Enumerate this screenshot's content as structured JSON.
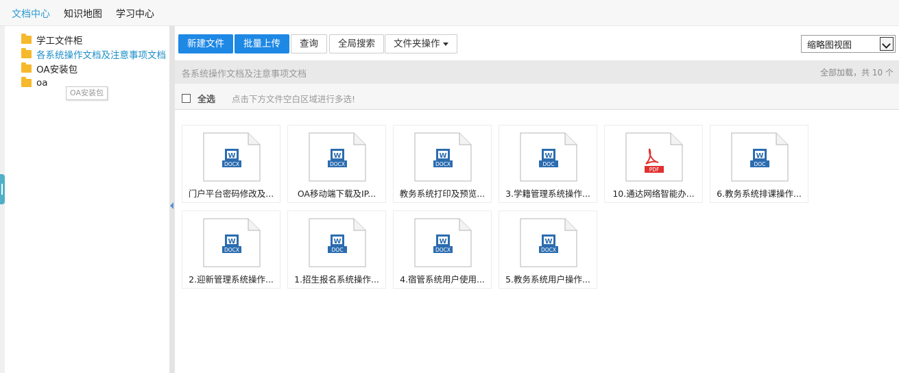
{
  "topnav": {
    "items": [
      {
        "label": "文档中心",
        "active": true
      },
      {
        "label": "知识地图",
        "active": false
      },
      {
        "label": "学习中心",
        "active": false
      }
    ]
  },
  "sidebar": {
    "folders": [
      {
        "label": "学工文件柜",
        "active": false
      },
      {
        "label": "各系统操作文档及注意事项文档",
        "active": true
      },
      {
        "label": "OA安装包",
        "active": false
      },
      {
        "label": "oa",
        "active": false
      }
    ],
    "tooltip": "OA安装包"
  },
  "toolbar": {
    "new_file": "新建文件",
    "batch_upload": "批量上传",
    "query": "查询",
    "global_search": "全局搜索",
    "folder_ops": "文件夹操作",
    "view_mode": "缩略图视图"
  },
  "pathbar": {
    "path": "各系统操作文档及注意事项文档",
    "count": "全部加载，共 10 个"
  },
  "selectbar": {
    "select_all": "全选",
    "hint": "点击下方文件空白区域进行多选!"
  },
  "colors": {
    "word": "#2b6cb0",
    "pdf": "#e03131",
    "primary": "#1e88e5",
    "active_text": "#1f8fc9"
  },
  "files": [
    {
      "name": "门户平台密码修改及...",
      "type": "DOCX",
      "icon": "word-icon"
    },
    {
      "name": "OA移动端下载及IP...",
      "type": "DOCX",
      "icon": "word-icon"
    },
    {
      "name": "教务系统打印及预览...",
      "type": "DOCX",
      "icon": "word-icon"
    },
    {
      "name": "3.学籍管理系统操作...",
      "type": "DOC",
      "icon": "word-icon"
    },
    {
      "name": "10.通达网络智能办...",
      "type": "PDF",
      "icon": "pdf-icon"
    },
    {
      "name": "6.教务系统排课操作...",
      "type": "DOC",
      "icon": "word-icon"
    },
    {
      "name": "2.迎新管理系统操作...",
      "type": "DOCX",
      "icon": "word-icon"
    },
    {
      "name": "1.招生报名系统操作...",
      "type": "DOC",
      "icon": "word-icon"
    },
    {
      "name": "4.宿管系统用户使用...",
      "type": "DOCX",
      "icon": "word-icon"
    },
    {
      "name": "5.教务系统用户操作...",
      "type": "DOCX",
      "icon": "word-icon"
    }
  ]
}
